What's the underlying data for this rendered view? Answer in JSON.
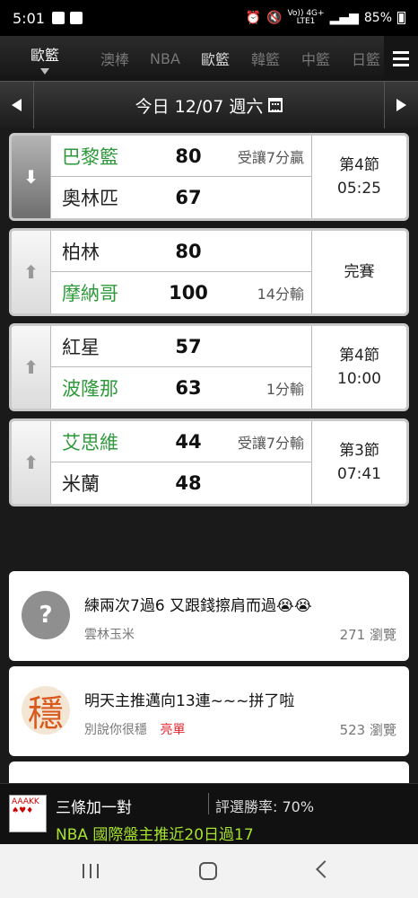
{
  "status_bar": {
    "time": "5:01",
    "network_top": "Vo)) 4G+",
    "network_bottom": "LTE1",
    "battery": "85%"
  },
  "league_tabs": {
    "selected": "歐籃",
    "items": [
      "澳棒",
      "NBA",
      "歐籃",
      "韓籃",
      "中籃",
      "日籃"
    ],
    "active_index": 2
  },
  "date_bar": {
    "label": "今日 12/07 週六"
  },
  "games": [
    {
      "direction": "down",
      "active": true,
      "home": {
        "name": "巴黎籃",
        "score": "80",
        "note": "受讓7分贏",
        "favored": true
      },
      "away": {
        "name": "奧林匹",
        "score": "67",
        "note": "",
        "favored": false
      },
      "status_line1": "第4節",
      "status_line2": "05:25"
    },
    {
      "direction": "up",
      "active": false,
      "home": {
        "name": "柏林",
        "score": "80",
        "note": "",
        "favored": false
      },
      "away": {
        "name": "摩納哥",
        "score": "100",
        "note": "14分輸",
        "favored": true
      },
      "status_line1": "完賽",
      "status_line2": ""
    },
    {
      "direction": "up",
      "active": false,
      "home": {
        "name": "紅星",
        "score": "57",
        "note": "",
        "favored": false
      },
      "away": {
        "name": "波隆那",
        "score": "63",
        "note": "1分輸",
        "favored": true
      },
      "status_line1": "第4節",
      "status_line2": "10:00"
    },
    {
      "direction": "up",
      "active": false,
      "home": {
        "name": "艾思維",
        "score": "44",
        "note": "受讓7分輸",
        "favored": true
      },
      "away": {
        "name": "米蘭",
        "score": "48",
        "note": "",
        "favored": false
      },
      "status_line1": "第3節",
      "status_line2": "07:41"
    }
  ],
  "posts": [
    {
      "title": "練兩次7過6 又跟錢擦肩而過😭😭",
      "author": "雲林玉米",
      "tag": "",
      "views": "271 瀏覽",
      "avatar_text": "?",
      "avatar_icon": "question-avatar-icon"
    },
    {
      "title": "明天主推邁向13連~~~拼了啦",
      "author": "別說你很穩",
      "tag": "亮單",
      "views": "523 瀏覽",
      "avatar_text": "穩",
      "avatar_icon": "wen-avatar-icon"
    }
  ],
  "banner": {
    "cards_text": "AAAKK",
    "title": "三條加一對",
    "rate": "評選勝率: 70%",
    "promo": "NBA 國際盤主推近20日過17"
  },
  "colors": {
    "favored_team": "#2e9a3a",
    "promo": "#a6e22e",
    "tag": "#e5262e"
  }
}
